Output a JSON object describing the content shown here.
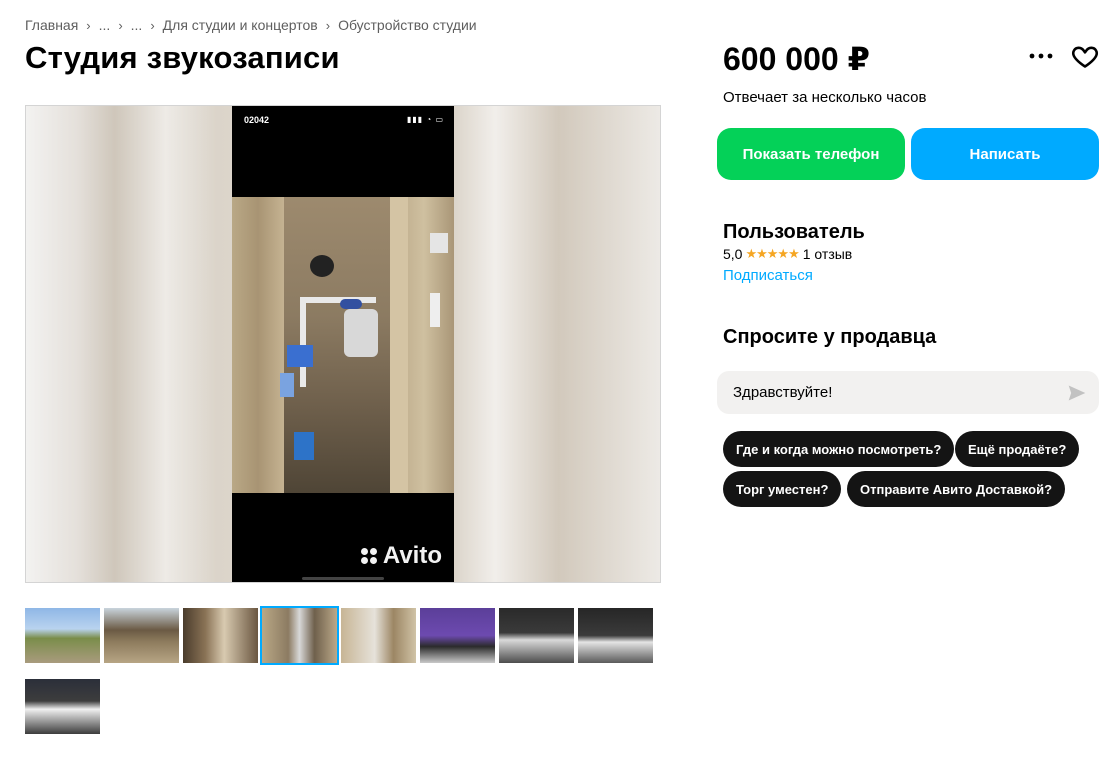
{
  "breadcrumb": [
    "Главная",
    "...",
    "...",
    "Для студии и концертов",
    "Обустройство студии"
  ],
  "listing": {
    "title": "Студия звукозаписи"
  },
  "photo": {
    "status_time": "02042",
    "status_icons": "▮▮▮ ◔ ▭",
    "watermark": "Avito"
  },
  "thumbnails": [
    "thumb-1",
    "thumb-2",
    "thumb-3",
    "thumb-4",
    "thumb-5",
    "thumb-6",
    "thumb-7",
    "thumb-8",
    "thumb-9"
  ],
  "active_thumbnail": 4,
  "sidebar": {
    "price": "600 000 ₽",
    "responds": "Отвечает за несколько часов",
    "show_phone": "Показать телефон",
    "write": "Написать"
  },
  "seller": {
    "name": "Пользователь",
    "rating": "5,0",
    "stars": "★★★★★",
    "reviews": "1 отзыв",
    "subscribe": "Подписаться"
  },
  "ask": {
    "title": "Спросите у продавца",
    "message": "Здравствуйте!",
    "quick_questions": [
      "Где и когда можно посмотреть?",
      "Ещё продаёте?",
      "Торг уместен?",
      "Отправите Авито Доставкой?"
    ]
  },
  "colors": {
    "green": "#04d158",
    "blue": "#00aaff",
    "dark": "#141414",
    "star": "#f5a623"
  }
}
